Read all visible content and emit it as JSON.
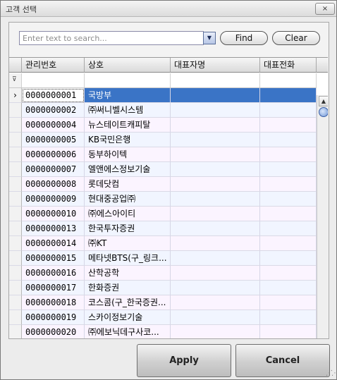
{
  "window": {
    "title": "고객 선택",
    "close_icon": "×"
  },
  "search": {
    "placeholder": "Enter text to search...",
    "value": "",
    "dropdown_icon": "▼",
    "find_label": "Find",
    "clear_label": "Clear"
  },
  "grid": {
    "columns": [
      "관리번호",
      "상호",
      "대표자명",
      "대표전화"
    ],
    "filter_icon": "⊽",
    "row_indicator": "›",
    "selected_index": 0,
    "rows": [
      [
        "0000000001",
        "국방부",
        "",
        ""
      ],
      [
        "0000000002",
        "㈜써니벨시스템",
        "",
        ""
      ],
      [
        "0000000004",
        "뉴스테이트캐피탈",
        "",
        ""
      ],
      [
        "0000000005",
        "KB국민은행",
        "",
        ""
      ],
      [
        "0000000006",
        "동부하이텍",
        "",
        ""
      ],
      [
        "0000000007",
        "엘앤에스정보기술",
        "",
        ""
      ],
      [
        "0000000008",
        "롯데닷컴",
        "",
        ""
      ],
      [
        "0000000009",
        "현대중공업㈜",
        "",
        ""
      ],
      [
        "0000000010",
        "㈜에스아이티",
        "",
        ""
      ],
      [
        "0000000013",
        "한국투자증권",
        "",
        ""
      ],
      [
        "0000000014",
        "㈜KT",
        "",
        ""
      ],
      [
        "0000000015",
        "메타넷BTS(구_링크...",
        "",
        ""
      ],
      [
        "0000000016",
        "산학공학",
        "",
        ""
      ],
      [
        "0000000017",
        "한화증권",
        "",
        ""
      ],
      [
        "0000000018",
        "코스콤(구_한국증권...",
        "",
        ""
      ],
      [
        "0000000019",
        "스카이정보기술",
        "",
        ""
      ],
      [
        "0000000020",
        "㈜에보닉데구사코...",
        "",
        ""
      ]
    ]
  },
  "scrollbar": {
    "up_icon": "▲",
    "down_icon": "▼"
  },
  "buttons": {
    "apply_label": "Apply",
    "cancel_label": "Cancel"
  }
}
